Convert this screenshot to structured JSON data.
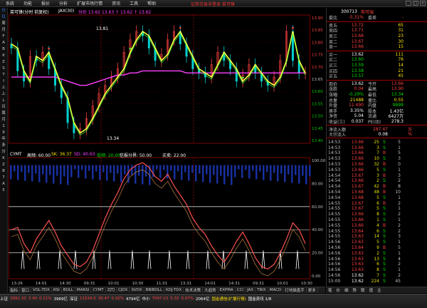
{
  "menu": {
    "items": [
      "系统",
      "功能",
      "报价",
      "分析",
      "扩展市场行情",
      "资讯",
      "工具",
      "帮助"
    ],
    "title": "证券交易未登录  菜可锋"
  },
  "left_toolbar": [
    "分",
    "日",
    "周",
    "月",
    "F",
    "A",
    "B",
    "K",
    "Z",
    "S",
    "T",
    "I",
    "上",
    "上",
    "L",
    "日",
    "周",
    "月",
    "1",
    "9",
    "年",
    "多",
    "分",
    "K",
    "Z",
    "B",
    "7",
    "A",
    "5"
  ],
  "chart": {
    "header": {
      "name": "菜可锋(分时 前复权)",
      "ma_label": "JAX(30)",
      "legend_text": "分价 13.62  13.63  ↑ 13.62  ↑ 13.62"
    },
    "price_axis": [
      "13.90",
      "13.85",
      "13.80",
      "13.75",
      "13.70",
      "13.65",
      "13.60",
      "13.55",
      "13.50",
      "13.45",
      "13.40"
    ],
    "annotations": {
      "high": "13.81",
      "low": "13.34"
    },
    "indicator_header": {
      "name": "CYMT",
      "items": [
        "高频: 60.00",
        "SK: 36.37",
        "SD: 40.63",
        "低频: 20.00",
        "信报分界: 50.00"
      ],
      "right": "买卖: 22.00"
    },
    "indicator_axis": [
      "100.00",
      "80.00",
      "60.00",
      "40.00",
      "20.00",
      "0.00"
    ],
    "time_axis": [
      "13:26",
      "14:01",
      "14:30",
      "09:31",
      "10:01",
      "10:30",
      "11:01",
      "13:31",
      "14:01",
      "14:31",
      "09:31",
      "10:01",
      "10:30"
    ]
  },
  "chart_data": {
    "type": "line",
    "price_series": {
      "name": "JAX(30)",
      "values": [
        13.78,
        13.76,
        13.65,
        13.6,
        13.72,
        13.7,
        13.74,
        13.66,
        13.58,
        13.52,
        13.4,
        13.35,
        13.37,
        13.42,
        13.48,
        13.54,
        13.58,
        13.62,
        13.66,
        13.74,
        13.8,
        13.84,
        13.82,
        13.76,
        13.7,
        13.73,
        13.8,
        13.84,
        13.78,
        13.72,
        13.66,
        13.64,
        13.62,
        13.68,
        13.74,
        13.7,
        13.66,
        13.6,
        13.63,
        13.68,
        13.64,
        13.6,
        13.58,
        13.62,
        13.7,
        13.84,
        13.7,
        13.64
      ]
    },
    "avg_series": {
      "values": [
        13.62,
        13.62,
        13.62,
        13.62,
        13.62,
        13.62,
        13.62,
        13.62,
        13.61,
        13.6,
        13.59,
        13.58,
        13.58,
        13.59,
        13.6,
        13.61,
        13.62,
        13.63,
        13.63,
        13.64,
        13.64,
        13.65,
        13.65,
        13.65,
        13.65,
        13.65,
        13.65,
        13.65,
        13.64,
        13.64,
        13.64,
        13.64,
        13.64,
        13.64,
        13.64,
        13.64,
        13.64,
        13.64,
        13.64,
        13.64,
        13.64,
        13.64,
        13.64,
        13.64,
        13.64,
        13.64,
        13.64,
        13.64
      ]
    },
    "indicator_values": [
      40,
      42,
      28,
      20,
      32,
      40,
      48,
      38,
      26,
      18,
      10,
      8,
      12,
      22,
      36,
      50,
      62,
      72,
      84,
      92,
      96,
      98,
      94,
      86,
      82,
      88,
      78,
      70,
      62,
      50,
      42,
      36,
      26,
      18,
      12,
      20,
      30,
      38,
      28,
      16,
      8,
      6,
      10,
      20,
      32,
      46,
      40,
      28
    ]
  },
  "quote": {
    "code": "300713",
    "name": "英可瑞",
    "wei": {
      "label": "委比",
      "pct": "-5.31%",
      "diff_label": "委差",
      "diff": "-"
    },
    "asks": [
      [
        "卖五",
        "13.72",
        "65"
      ],
      [
        "卖四",
        "13.71",
        "31"
      ],
      [
        "卖三",
        "13.68",
        "23"
      ],
      [
        "卖二",
        "13.67",
        "30"
      ],
      [
        "卖一",
        "13.66",
        "15"
      ]
    ],
    "bids": [
      [
        "买一",
        "13.62",
        "111"
      ],
      [
        "买二",
        "13.60",
        "76"
      ],
      [
        "买三",
        "13.59",
        "14"
      ],
      [
        "买四",
        "13.58",
        "21"
      ],
      [
        "买五",
        "13.57",
        "45"
      ]
    ],
    "stats": [
      [
        "现价",
        "13.62",
        "今开",
        "13.66"
      ],
      [
        "涨跌",
        "0.04",
        "最高",
        "13.90"
      ],
      [
        "涨幅",
        "-0.29%",
        "最低",
        "13.34"
      ],
      [
        "总量",
        "21488",
        "量比",
        "0.55"
      ],
      [
        "外盘",
        "11.490",
        "内盘",
        "9999"
      ],
      [
        "换手",
        "3.35%",
        "股本",
        "1.43亿"
      ],
      [
        "净资",
        "5.04",
        "流通",
        "6427万"
      ],
      [
        "收益(三)",
        "0.037",
        "PE(动)",
        "278.3"
      ]
    ],
    "flow": [
      [
        "净流入额",
        "287.47",
        "万"
      ],
      [
        "大宗流入",
        "0.08",
        "%"
      ]
    ],
    "ticks": [
      [
        "14:53",
        "13.66",
        "25",
        "S",
        "5"
      ],
      [
        "14:53",
        "13.66",
        "3",
        "S",
        "1"
      ],
      [
        "14:53",
        "13.66",
        "7",
        "B",
        "5"
      ],
      [
        "14:53",
        "13.66",
        "10",
        "S",
        "3"
      ],
      [
        "14:53",
        "13.66",
        "32",
        "B",
        "0"
      ],
      [
        "14:53",
        "13.66",
        "5",
        "S",
        "1"
      ],
      [
        "14:54",
        "13.67",
        "3",
        "B",
        "3"
      ],
      [
        "14:54",
        "13.66",
        "2",
        "S",
        "2"
      ],
      [
        "14:54",
        "13.67",
        "42",
        "B",
        "8"
      ],
      [
        "14:54",
        "13.68",
        "48",
        "B",
        "10"
      ],
      [
        "14:54",
        "13.68",
        "5",
        "S",
        "1"
      ],
      [
        "14:55",
        "13.67",
        "6",
        "B",
        "2"
      ],
      [
        "14:55",
        "13.67",
        "5",
        "S",
        "1"
      ],
      [
        "14:55",
        "13.66",
        "8",
        "S",
        "2"
      ],
      [
        "14:55",
        "13.66",
        "1",
        "S",
        "1"
      ],
      [
        "14:55",
        "13.66",
        "4",
        "B",
        "2"
      ],
      [
        "14:55",
        "13.64",
        "6",
        "S",
        "2"
      ],
      [
        "14:55",
        "13.63",
        "14",
        "S",
        "3"
      ],
      [
        "14:56",
        "13.63",
        "5",
        "S",
        "1"
      ],
      [
        "14:56",
        "13.64",
        "9",
        "B",
        "5"
      ],
      [
        "14:56",
        "13.63",
        "2",
        "S",
        "1"
      ],
      [
        "14:56",
        "13.63",
        "13",
        "S",
        "4"
      ],
      [
        "14:56",
        "13.63",
        "6",
        "S",
        "2"
      ],
      [
        "14:56",
        "13.63",
        "8",
        "S",
        "1"
      ],
      [
        "14:56",
        "13.62",
        "7",
        "S",
        "2"
      ],
      [
        "15:00",
        "13.62",
        "224",
        "S",
        "45"
      ]
    ]
  },
  "bottom_tabs": [
    "指标",
    "窗口",
    "VOL-TDX",
    "RSI",
    "BOLL",
    "MARSI",
    "CYMT",
    "ZJTJ",
    "CJDX",
    "SVDX",
    "BBIBOLL",
    "KDJ-TDX",
    "技术决策",
    "大趋势",
    "EXPMA",
    "CCI",
    "JAX",
    "TRIX",
    "MACD",
    "打地猫盘手",
    "更多"
  ],
  "rp_tabs": [
    "笔",
    "价",
    "细",
    "势",
    "联",
    "值",
    "主"
  ],
  "status": [
    {
      "text": "上证",
      "cls": "white"
    },
    {
      "text": "2991.33",
      "cls": "red"
    },
    {
      "text": "3.40",
      "cls": "red"
    },
    {
      "text": "0.11%",
      "cls": "red"
    },
    {
      "text": "3969亿",
      "cls": "white"
    },
    {
      "text": "深证",
      "cls": "white"
    },
    {
      "text": "11534.0",
      "cls": "red"
    },
    {
      "text": "36.47",
      "cls": "red"
    },
    {
      "text": "0.32%",
      "cls": "red"
    },
    {
      "text": "4794亿",
      "cls": "white"
    },
    {
      "text": "中小",
      "cls": "white"
    },
    {
      "text": "7597.13",
      "cls": "red"
    },
    {
      "text": "5.32",
      "cls": "red"
    },
    {
      "text": "0.07%",
      "cls": "red"
    },
    {
      "text": "2064亿",
      "cls": "white"
    },
    {
      "text": "国金通信(扩展行情)",
      "cls": "yellow"
    },
    {
      "text": "国金资讯 1/8",
      "cls": "white"
    }
  ]
}
